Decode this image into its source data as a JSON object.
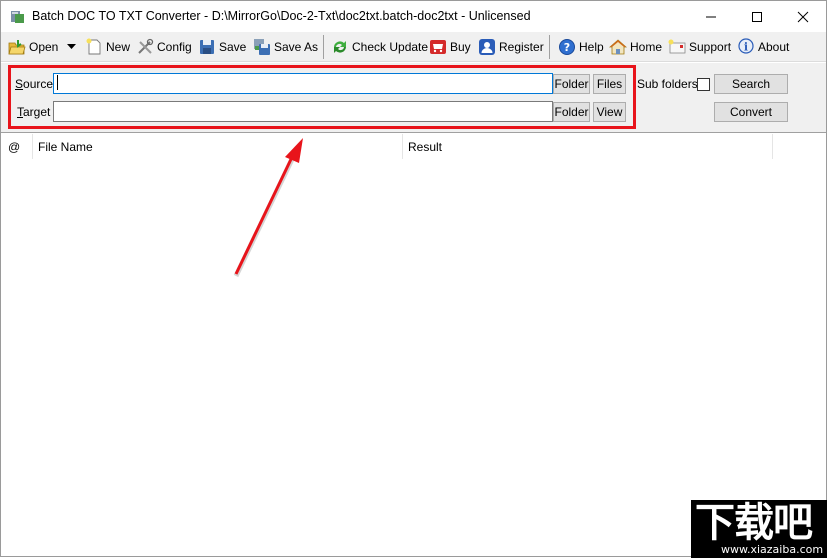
{
  "window": {
    "title": "Batch DOC TO TXT Converter - D:\\MirrorGo\\Doc-2-Txt\\doc2txt.batch-doc2txt - Unlicensed",
    "controls": [
      "minimize",
      "maximize",
      "close"
    ]
  },
  "toolbar": {
    "items": [
      {
        "label": "Open",
        "icon": "open-folder-icon"
      },
      {
        "label": "",
        "icon": "dropdown-arrow-icon"
      },
      {
        "label": "New",
        "icon": "new-file-icon"
      },
      {
        "label": "Config",
        "icon": "tools-icon"
      },
      {
        "label": "Save",
        "icon": "floppy-disk-icon"
      },
      {
        "label": "Save As",
        "icon": "save-as-icon"
      },
      {
        "label": "Check Update",
        "icon": "refresh-icon"
      },
      {
        "label": "Buy",
        "icon": "shopping-cart-icon"
      },
      {
        "label": "Register",
        "icon": "user-icon"
      },
      {
        "label": "Help",
        "icon": "help-icon"
      },
      {
        "label": "Home",
        "icon": "home-icon"
      },
      {
        "label": "Support",
        "icon": "mail-icon"
      },
      {
        "label": "About",
        "icon": "info-icon"
      }
    ]
  },
  "panel": {
    "source": {
      "label_first": "S",
      "label_rest": "ource",
      "value": "",
      "placeholder": ""
    },
    "target": {
      "label_first": "T",
      "label_rest": "arget",
      "value": "",
      "placeholder": ""
    },
    "source_folder_button": "Folder",
    "source_files_button": "Files",
    "target_folder_button": "Folder",
    "target_view_button": "View",
    "subfolders_label": "Sub folders",
    "subfolders_checked": false,
    "search_button": "Search",
    "convert_button": "Convert"
  },
  "list": {
    "columns": [
      "@",
      "File Name",
      "Result",
      ""
    ],
    "rows": []
  },
  "colors": {
    "highlight": "#e8141b",
    "accent": "#0078d7",
    "panel_bg": "#f0f0f0"
  },
  "watermark": {
    "main": "下载吧",
    "url": "www.xiazaiba.com"
  }
}
